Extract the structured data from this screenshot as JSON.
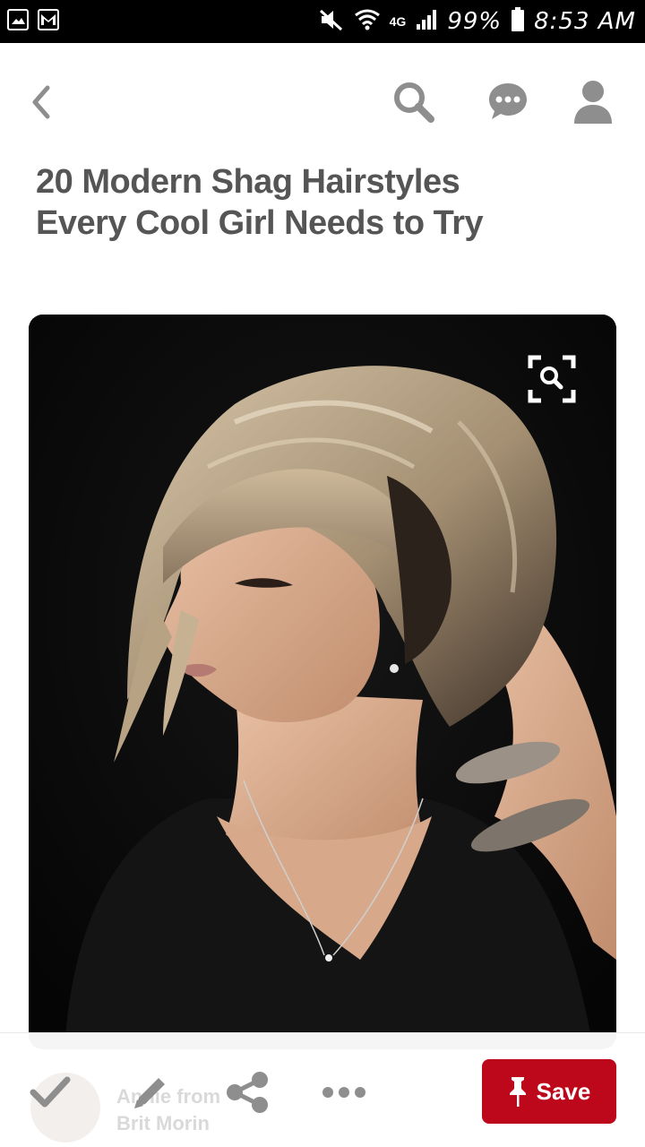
{
  "status_bar": {
    "battery": "99%",
    "time": "8:53 AM",
    "network": "4G",
    "icons": [
      "gallery-icon",
      "gmail-icon",
      "mute-icon",
      "wifi-icon",
      "signal-icon",
      "battery-icon"
    ]
  },
  "nav": {
    "icons": [
      "back-icon",
      "search-icon",
      "messages-icon",
      "profile-icon"
    ]
  },
  "pin": {
    "title": "20 Modern Shag Hairstyles Every Cool Girl Needs to Try",
    "image_alt_icon": "visual-search-icon"
  },
  "bottom_bar": {
    "attribution_line1": "Annie from",
    "attribution_line2": "Brit Morin",
    "save_label": "Save",
    "icons": [
      "done-check-icon",
      "edit-pencil-icon",
      "share-icon",
      "more-icon",
      "pin-icon"
    ]
  },
  "colors": {
    "accent": "#bd081c",
    "nav_icon": "#8e8e8e",
    "title": "#555555"
  }
}
